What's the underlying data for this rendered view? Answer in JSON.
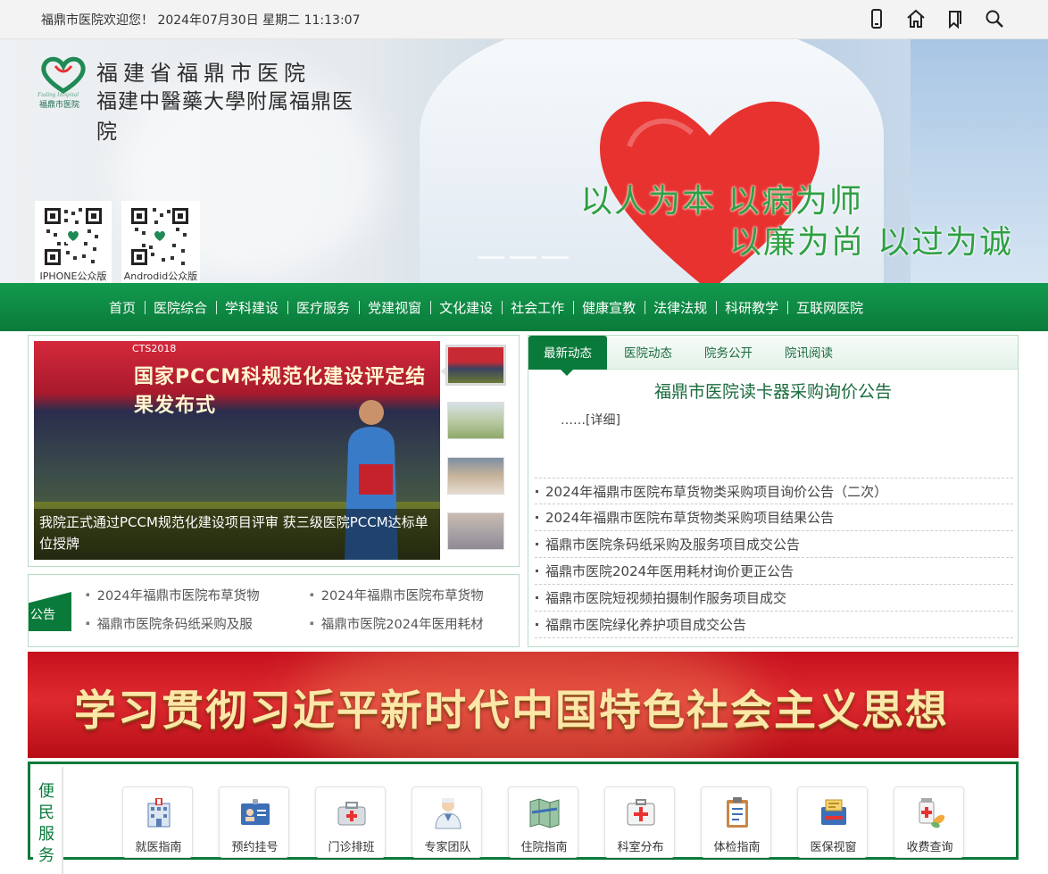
{
  "topbar": {
    "welcome": "福鼎市医院欢迎您！  2024年07月30日  星期二 11:13:07",
    "icons": [
      "mobile-icon",
      "home-icon",
      "bookmark-icon",
      "search-icon"
    ]
  },
  "banner": {
    "logo_line1": "福建省福鼎市医院",
    "logo_line2": "福建中醫藥大學附属福鼎医院",
    "logo_en": "Fuding Hospital",
    "logo_cn_small": "福鼎市医院",
    "slogans": [
      "以人为本",
      "以病为师",
      "以廉为尚",
      "以过为诚"
    ],
    "qr_labels": [
      "IPHONE公众版",
      "Androdid公众版"
    ]
  },
  "nav": {
    "items": [
      "首页",
      "医院综合",
      "学科建设",
      "医疗服务",
      "党建视窗",
      "文化建设",
      "社会工作",
      "健康宣教",
      "法律法规",
      "科研教学",
      "互联网医院"
    ]
  },
  "slider": {
    "sign_text": "国家PCCM科规范化建设评定结果发布式",
    "sign_logo": "CTS2018",
    "caption": "我院正式通过PCCM规范化建设项目评审 获三级医院PCCM达标单位授牌",
    "thumb_count": 4
  },
  "notice": {
    "tag": "公告",
    "items": [
      "2024年福鼎市医院布草货物",
      "2024年福鼎市医院布草货物",
      "福鼎市医院条码纸采购及服",
      "福鼎市医院2024年医用耗材"
    ]
  },
  "news": {
    "tabs": [
      "最新动态",
      "医院动态",
      "院务公开",
      "院讯阅读"
    ],
    "headline": "福鼎市医院读卡器采购询价公告",
    "detail": "……[详细]",
    "list": [
      "2024年福鼎市医院布草货物类采购项目询价公告（二次）",
      "2024年福鼎市医院布草货物类采购项目结果公告",
      "福鼎市医院条码纸采购及服务项目成交公告",
      "福鼎市医院2024年医用耗材询价更正公告",
      "福鼎市医院短视频拍摄制作服务项目成交",
      "福鼎市医院绿化养护项目成交公告"
    ]
  },
  "red_banner": {
    "text": "学习贯彻习近平新时代中国特色社会主义思想"
  },
  "services": {
    "label": "便民服务",
    "items": [
      {
        "label": "就医指南",
        "icon": "hospital-building-icon"
      },
      {
        "label": "预约挂号",
        "icon": "id-card-icon"
      },
      {
        "label": "门诊排班",
        "icon": "medical-kit-icon"
      },
      {
        "label": "专家团队",
        "icon": "doctor-icon"
      },
      {
        "label": "住院指南",
        "icon": "map-icon"
      },
      {
        "label": "科室分布",
        "icon": "first-aid-icon"
      },
      {
        "label": "体检指南",
        "icon": "clipboard-icon"
      },
      {
        "label": "医保视窗",
        "icon": "insurance-icon"
      },
      {
        "label": "收费查询",
        "icon": "medicine-icon"
      }
    ]
  },
  "colors": {
    "primary_green": "#0a7a3a",
    "nav_green": "#129a4e",
    "slogan_green": "#2ea043",
    "heart_red": "#e8322f",
    "banner_red": "#c6111d",
    "banner_gold_text": "#fbe7a8"
  }
}
